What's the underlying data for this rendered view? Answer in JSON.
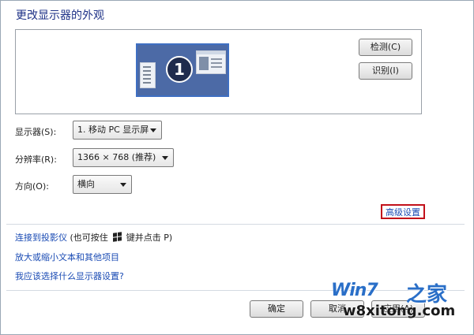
{
  "title": "更改显示器的外观",
  "preview": {
    "monitor_number": "1",
    "detect_button": "检测(C)",
    "identify_button": "识别(I)"
  },
  "settings": {
    "display_label": "显示器(S):",
    "display_value": "1. 移动 PC 显示屏",
    "resolution_label": "分辨率(R):",
    "resolution_value": "1366 × 768 (推荐)",
    "orientation_label": "方向(O):",
    "orientation_value": "横向"
  },
  "advanced_settings_link": "高级设置",
  "links": {
    "projector_link": "连接到投影仪",
    "projector_hint_prefix": "(也可按住",
    "projector_hint_suffix": "键并点击 P)",
    "text_size_link": "放大或缩小文本和其他项目",
    "which_settings_link": "我应该选择什么显示器设置?"
  },
  "footer": {
    "ok_button": "确定",
    "cancel_button": "取消",
    "apply_button": "应用(A)"
  },
  "watermark": {
    "logo_text": "Win7",
    "logo_suffix": "之家",
    "url_text": "w8xitong.com"
  },
  "colors": {
    "title": "#1e3287",
    "link": "#1a4bb4",
    "highlight_box": "#c2101a",
    "monitor_fill": "#4c6aa6"
  },
  "icons": {
    "windows_key": "windows-logo-icon",
    "dropdown_arrow": "chevron-down-icon"
  }
}
